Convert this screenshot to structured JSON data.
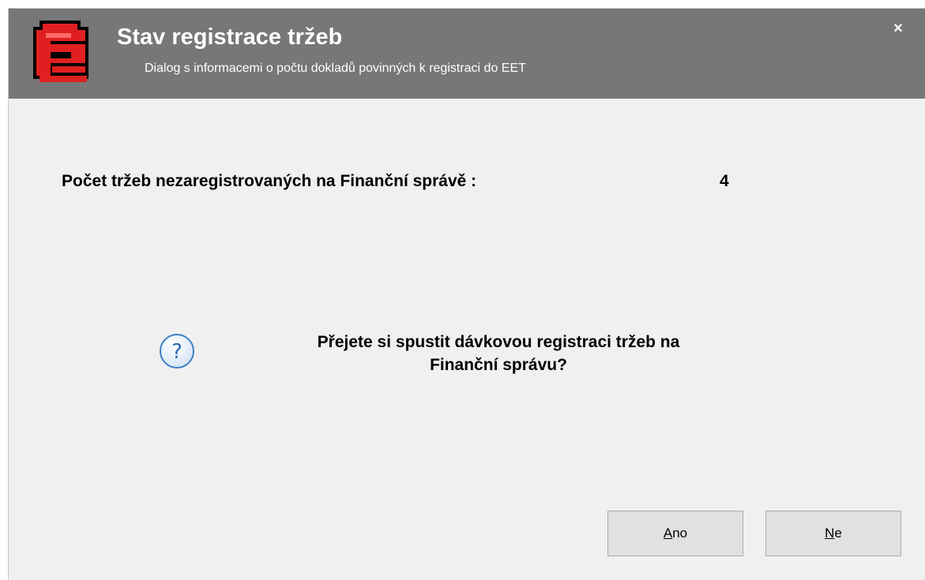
{
  "header": {
    "title": "Stav registrace tržeb",
    "subtitle": "Dialog s informacemi o počtu dokladů povinných k registraci do EET",
    "close_label": "×",
    "background_color": "#777777"
  },
  "content": {
    "count_label": "Počet tržeb nezaregistrovaných na Finanční správě :",
    "count_value": "4",
    "question_line1": "Přejete si spustit dávkovou registraci tržeb na",
    "question_line2": "Finanční správu?",
    "question_icon": "question-icon"
  },
  "buttons": {
    "yes": {
      "mnemonic": "A",
      "rest": "no"
    },
    "no": {
      "mnemonic": "N",
      "rest": "e"
    }
  },
  "colors": {
    "logo_red": "#e02020",
    "dialog_bg": "#f0f0f0",
    "button_bg": "#e1e1e1"
  }
}
